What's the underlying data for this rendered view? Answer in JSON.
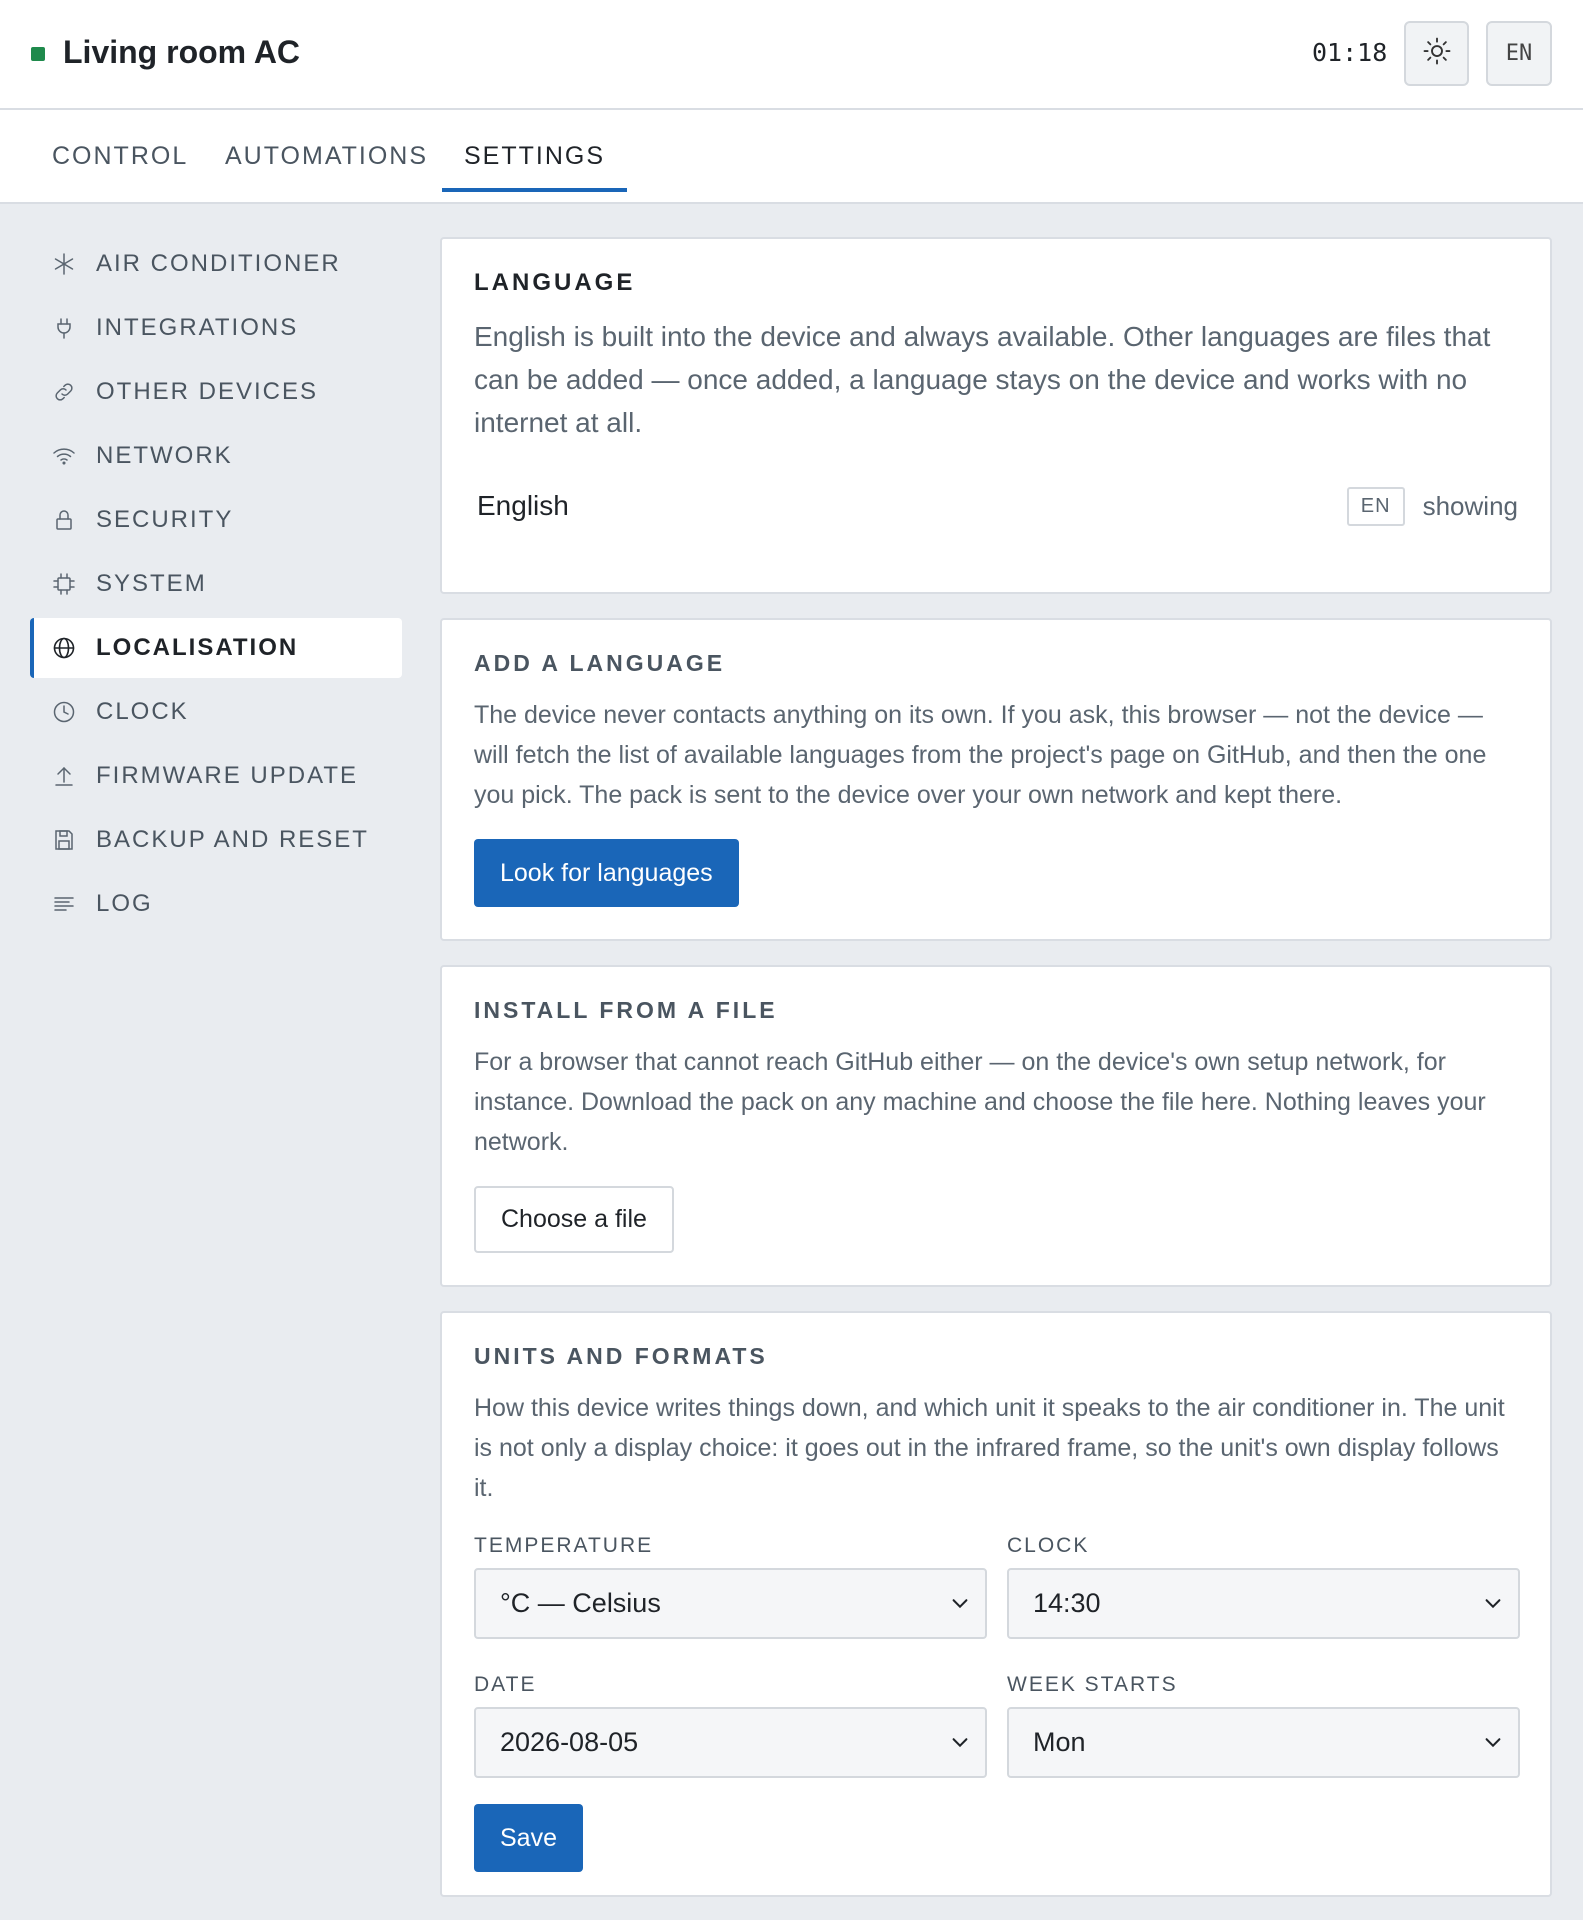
{
  "header": {
    "title": "Living room AC",
    "status_color": "#1f8a4c",
    "time": "01:18",
    "theme_icon": "sun-icon",
    "lang_button": "EN"
  },
  "tabs": [
    {
      "label": "CONTROL",
      "active": false
    },
    {
      "label": "AUTOMATIONS",
      "active": false
    },
    {
      "label": "SETTINGS",
      "active": true
    }
  ],
  "sidebar": {
    "items": [
      {
        "label": "AIR CONDITIONER",
        "icon": "snowflake-icon"
      },
      {
        "label": "INTEGRATIONS",
        "icon": "plug-icon"
      },
      {
        "label": "OTHER DEVICES",
        "icon": "link-icon"
      },
      {
        "label": "NETWORK",
        "icon": "wifi-icon"
      },
      {
        "label": "SECURITY",
        "icon": "lock-icon"
      },
      {
        "label": "SYSTEM",
        "icon": "chip-icon"
      },
      {
        "label": "LOCALISATION",
        "icon": "globe-icon",
        "active": true
      },
      {
        "label": "CLOCK",
        "icon": "clock-icon"
      },
      {
        "label": "FIRMWARE UPDATE",
        "icon": "upload-icon"
      },
      {
        "label": "BACKUP AND RESET",
        "icon": "save-icon"
      },
      {
        "label": "LOG",
        "icon": "lines-icon"
      }
    ]
  },
  "language": {
    "title": "LANGUAGE",
    "desc": "English is built into the device and always available. Other languages are files that can be added — once added, a language stays on the device and works with no internet at all.",
    "current_name": "English",
    "current_code": "EN",
    "current_state": "showing"
  },
  "add_language": {
    "title": "ADD A LANGUAGE",
    "desc": "The device never contacts anything on its own. If you ask, this browser — not the device — will fetch the list of available languages from the project's page on GitHub, and then the one you pick. The pack is sent to the device over your own network and kept there.",
    "button": "Look for languages"
  },
  "install_file": {
    "title": "INSTALL FROM A FILE",
    "desc": "For a browser that cannot reach GitHub either — on the device's own setup network, for instance. Download the pack on any machine and choose the file here. Nothing leaves your network.",
    "button": "Choose a file"
  },
  "units": {
    "title": "UNITS AND FORMATS",
    "desc": "How this device writes things down, and which unit it speaks to the air conditioner in. The unit is not only a display choice: it goes out in the infrared frame, so the unit's own display follows it.",
    "temperature_label": "TEMPERATURE",
    "temperature_value": "°C — Celsius",
    "clock_label": "CLOCK",
    "clock_value": "14:30",
    "date_label": "DATE",
    "date_value": "2026-08-05",
    "week_label": "WEEK STARTS",
    "week_value": "Mon",
    "save_button": "Save"
  },
  "colors": {
    "accent": "#1a66b8",
    "page_bg": "#e9ecf0"
  }
}
